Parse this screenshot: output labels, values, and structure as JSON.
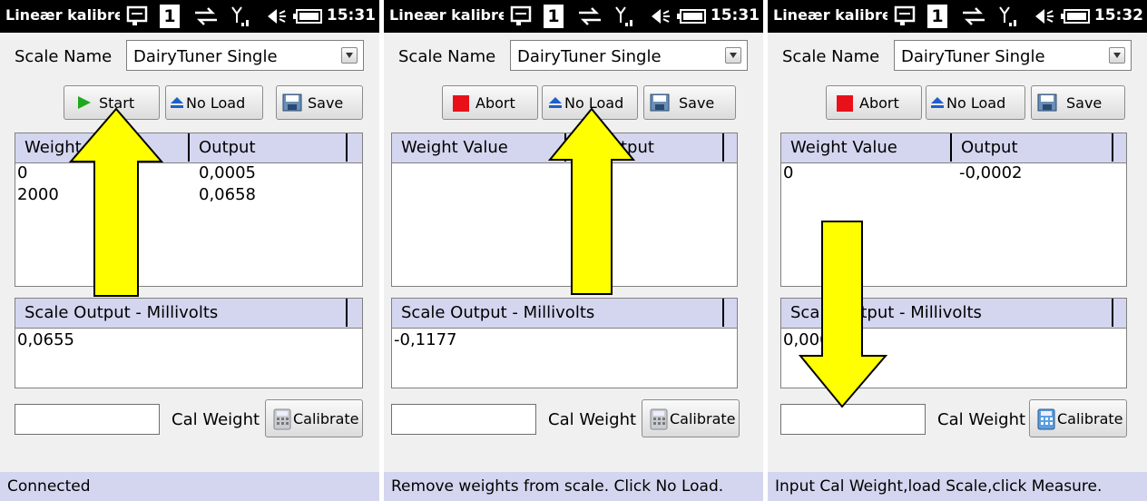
{
  "panels": [
    {
      "title": "Lineær kalibre",
      "time": "15:31",
      "sim_number": "1",
      "scale_label": "Scale Name",
      "scale_value": "DairyTuner Single",
      "buttons": [
        "Start",
        "No Load",
        "Save"
      ],
      "grid_headers": [
        "Weight",
        "Output"
      ],
      "rows": [
        [
          "0",
          "0,0005"
        ],
        [
          "2000",
          "0,0658"
        ]
      ],
      "output_header": "Scale Output - Millivolts",
      "output_value": "0,0655",
      "cal_weight_value": "",
      "cal_weight_label": "Cal Weight",
      "calibrate_label": "Calibrate",
      "status": "Connected"
    },
    {
      "title": "Lineær kalibre",
      "time": "15:31",
      "sim_number": "1",
      "scale_label": "Scale Name",
      "scale_value": "DairyTuner Single",
      "buttons": [
        "Abort",
        "No Load",
        "Save"
      ],
      "grid_headers": [
        "Weight Value",
        "tput"
      ],
      "rows": [],
      "output_header": "Scale Output - Millivolts",
      "output_value": "-0,1177",
      "cal_weight_value": "",
      "cal_weight_label": "Cal Weight",
      "calibrate_label": "Calibrate",
      "status": "Remove weights from scale. Click No Load."
    },
    {
      "title": "Lineær kalibre",
      "time": "15:32",
      "sim_number": "1",
      "scale_label": "Scale Name",
      "scale_value": "DairyTuner Single",
      "buttons": [
        "Abort",
        "No Load",
        "Save"
      ],
      "grid_headers": [
        "Weight Value",
        "Output"
      ],
      "rows": [
        [
          "0",
          "-0,0002"
        ]
      ],
      "output_header_parts": [
        "Scal",
        "tput - Millivolts"
      ],
      "output_value": "0,000",
      "cal_weight_value": "",
      "cal_weight_label": "Cal Weight",
      "calibrate_label": "Calibrate",
      "status": "Input Cal Weight,load Scale,click Measure."
    }
  ],
  "icons": {
    "start": "play-icon",
    "abort": "stop-icon",
    "no_load": "eject-icon",
    "save": "floppy-icon",
    "calibrate": "calculator-icon",
    "annotation": "yellow-arrow"
  },
  "colors": {
    "header_bg": "#d4d6f0",
    "arrow_fill": "#ffff00",
    "stop_red": "#e8111a",
    "play_green": "#1fa81f",
    "eject_blue": "#1e5fc8"
  }
}
